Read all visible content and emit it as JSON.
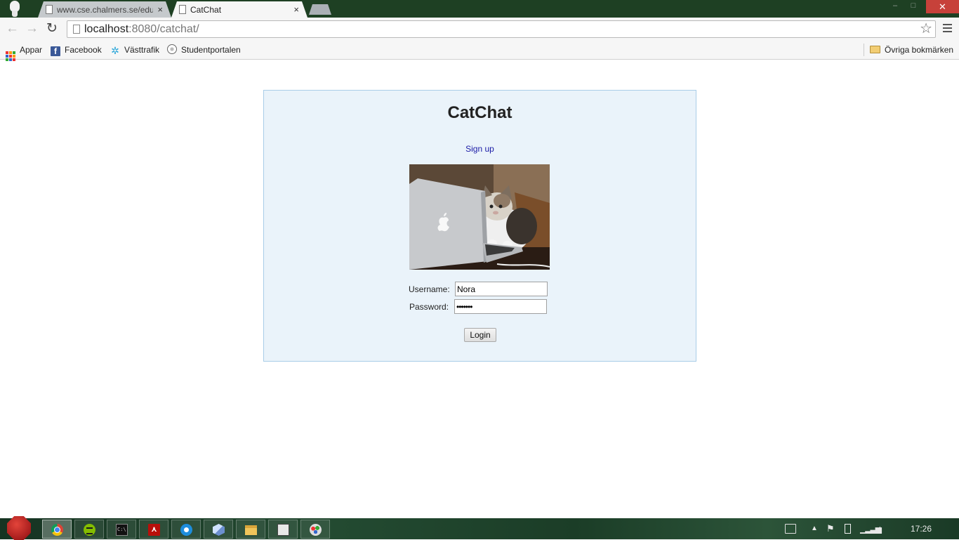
{
  "browser": {
    "tabs": [
      {
        "title": "www.cse.chalmers.se/edu",
        "active": false
      },
      {
        "title": "CatChat",
        "active": true
      }
    ],
    "tab_close_glyph": "×",
    "address": {
      "host": "localhost",
      "path": ":8080/catchat/"
    },
    "bookmarks": [
      {
        "label": "Appar",
        "icon": "apps-icon"
      },
      {
        "label": "Facebook",
        "icon": "facebook-icon"
      },
      {
        "label": "Västtrafik",
        "icon": "vasttrafik-icon"
      },
      {
        "label": "Studentportalen",
        "icon": "studentportalen-icon"
      }
    ],
    "other_bookmarks": {
      "label": "Övriga bokmärken",
      "icon": "folder-icon"
    }
  },
  "page": {
    "title": "CatChat",
    "signup_link": "Sign up",
    "image": {
      "description_icon": "cat-at-laptop-photo"
    },
    "form": {
      "username_label": "Username:",
      "username_value": "Nora",
      "password_label": "Password:",
      "password_value": "•••••••",
      "login_label": "Login"
    }
  },
  "taskbar": {
    "apps": [
      "chrome",
      "spotify",
      "cmd",
      "acrobat",
      "skype",
      "virtualbox",
      "explorer",
      "clipboard",
      "paint"
    ],
    "active_app": "chrome",
    "clock": "17:26"
  },
  "colors": {
    "panel_bg": "#eaf3fa",
    "panel_border": "#a9cde8",
    "link": "#1a1aa6",
    "tabstrip": "#1e4023",
    "close_button": "#c7413a"
  }
}
